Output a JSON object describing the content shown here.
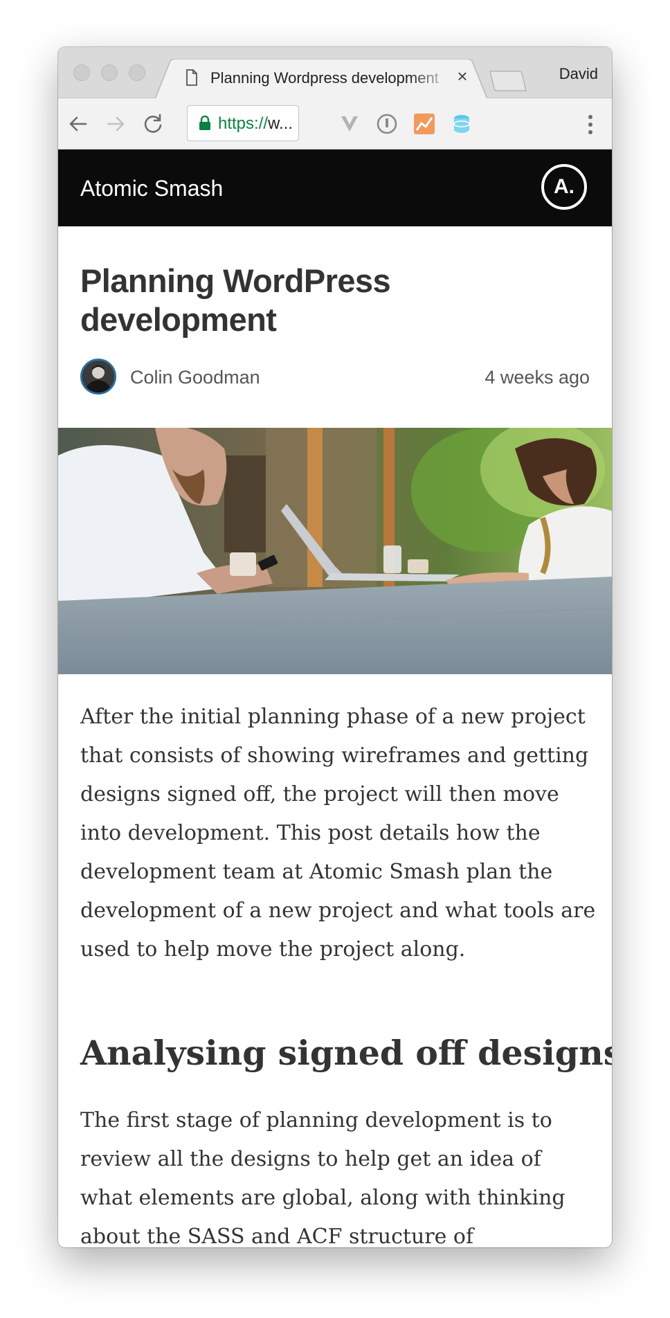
{
  "browser": {
    "tab_title": "Planning Wordpress development",
    "tab_close": "×",
    "profile_name": "David",
    "url_scheme": "https://",
    "url_rest": "w...",
    "icons": {
      "back": "arrow-left-icon",
      "forward": "arrow-right-icon",
      "reload": "reload-icon",
      "lock": "lock-icon",
      "menu": "vertical-dots-icon"
    },
    "extensions": [
      "vivaldi-v-icon",
      "onepassword-icon",
      "analytics-chart-icon",
      "database-icon"
    ],
    "colors": {
      "tabstrip": "#dadada",
      "toolbar": "#f2f2f2",
      "secure_green": "#0b8043"
    }
  },
  "site": {
    "name": "Atomic Smash",
    "logo_text": "A.",
    "header_color": "#0b0b0b"
  },
  "article": {
    "title": "Planning WordPress development",
    "author": "Colin Goodman",
    "date": "4 weeks ago",
    "hero_image": "two people working at laptops at an outdoor table",
    "paragraph1": "After the initial planning phase of a new project that consists of showing wireframes and getting designs signed off, the project will then move into development. This post details how the development team at Atomic Smash plan the development of a new project and what tools are used to help move the project along.",
    "subheading": "Analysing signed off designs",
    "paragraph2": "The first stage of planning development is to review all the designs to help get an idea of what elements are global, along with thinking about the SASS and ACF structure of"
  }
}
